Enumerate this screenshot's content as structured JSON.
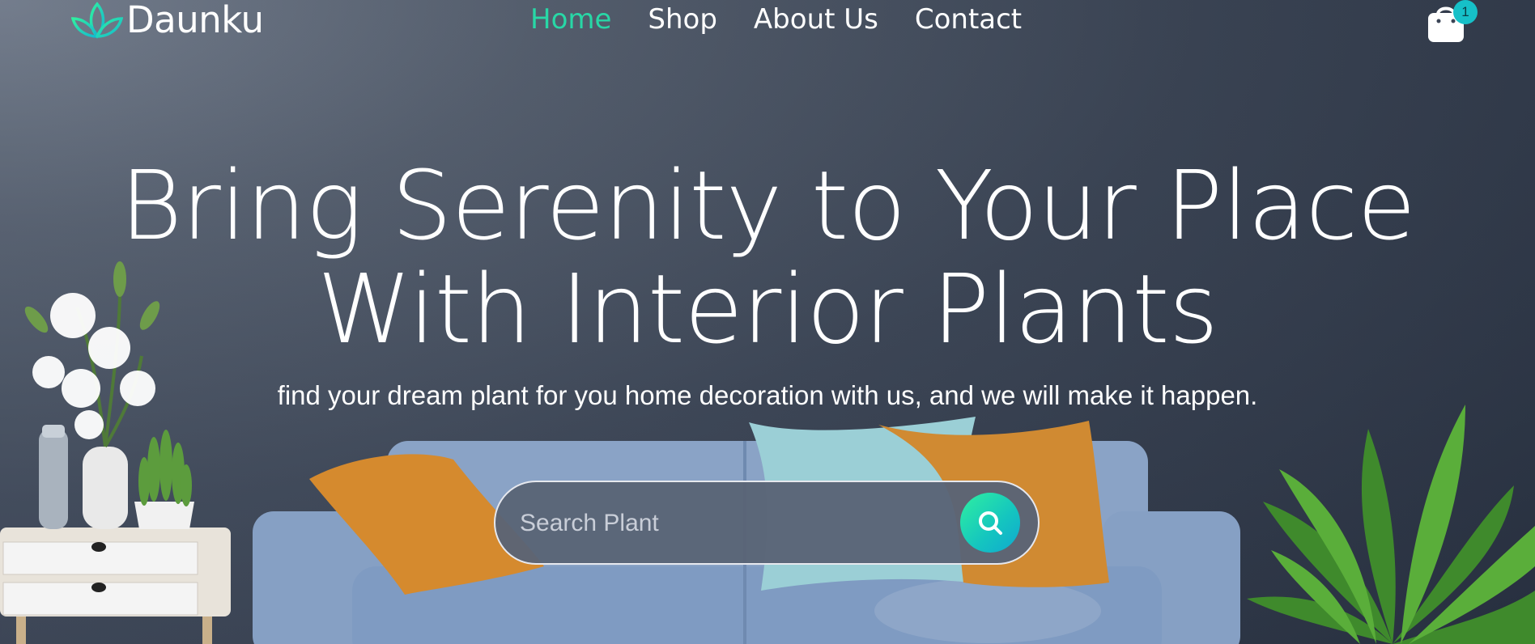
{
  "brand": {
    "name": "Daunku",
    "accent": "#28d7a6"
  },
  "nav": {
    "items": [
      {
        "label": "Home",
        "active": true
      },
      {
        "label": "Shop",
        "active": false
      },
      {
        "label": "About Us",
        "active": false
      },
      {
        "label": "Contact",
        "active": false
      }
    ]
  },
  "cart": {
    "count": "1",
    "icon": "shopping-bag-icon"
  },
  "hero": {
    "headline_line1": "Bring Serenity to Your Place",
    "headline_line2": "With Interior Plants",
    "subtitle": "find your dream plant for you home decoration with us, and we will make it happen."
  },
  "search": {
    "placeholder": "Search Plant",
    "value": "",
    "icon": "search-icon"
  }
}
